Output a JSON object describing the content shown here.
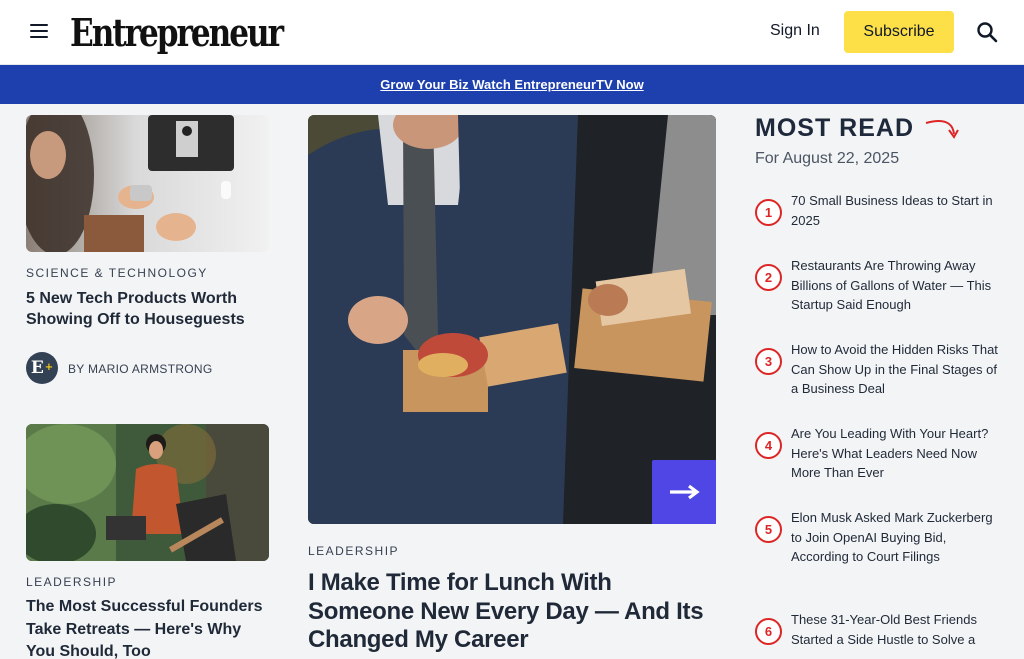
{
  "header": {
    "logo": "Entrepreneur",
    "sign_in": "Sign In",
    "subscribe": "Subscribe"
  },
  "promo": {
    "link_text": "Grow Your Biz Watch EntrepreneurTV Now"
  },
  "left_cards": [
    {
      "category": "SCIENCE & TECHNOLOGY",
      "headline": "5 New Tech Products Worth Showing Off to Houseguests",
      "author": "BY MARIO ARMSTRONG"
    },
    {
      "category": "LEADERSHIP",
      "headline": "The Most Successful Founders Take Retreats — Here's Why You Should, Too"
    }
  ],
  "hero": {
    "category": "LEADERSHIP",
    "headline": "I Make Time for Lunch With Someone New Every Day — And Its Changed My Career"
  },
  "most_read": {
    "title": "MOST READ",
    "date": "For August 22, 2025",
    "items": [
      {
        "num": "1",
        "text": "70 Small Business Ideas to Start in 2025"
      },
      {
        "num": "2",
        "text": "Restaurants Are Throwing Away Billions of Gallons of Water — This Startup Said Enough"
      },
      {
        "num": "3",
        "text": "How to Avoid the Hidden Risks That Can Show Up in the Final Stages of a Business Deal"
      },
      {
        "num": "4",
        "text": "Are You Leading With Your Heart? Here's What Leaders Need Now More Than Ever"
      },
      {
        "num": "5",
        "text": "Elon Musk Asked Mark Zuckerberg to Join OpenAI Buying Bid, According to Court Filings"
      },
      {
        "num": "6",
        "text": "These 31-Year-Old Best Friends Started a Side Hustle to Solve a"
      }
    ]
  },
  "colors": {
    "promo_bg": "#1e40af",
    "subscribe_bg": "#fde047",
    "accent_red": "#dc2626",
    "hero_arrow_bg": "#4f46e5"
  },
  "icons": [
    "menu-icon",
    "search-icon",
    "arrow-right-icon",
    "curved-arrow-icon"
  ]
}
